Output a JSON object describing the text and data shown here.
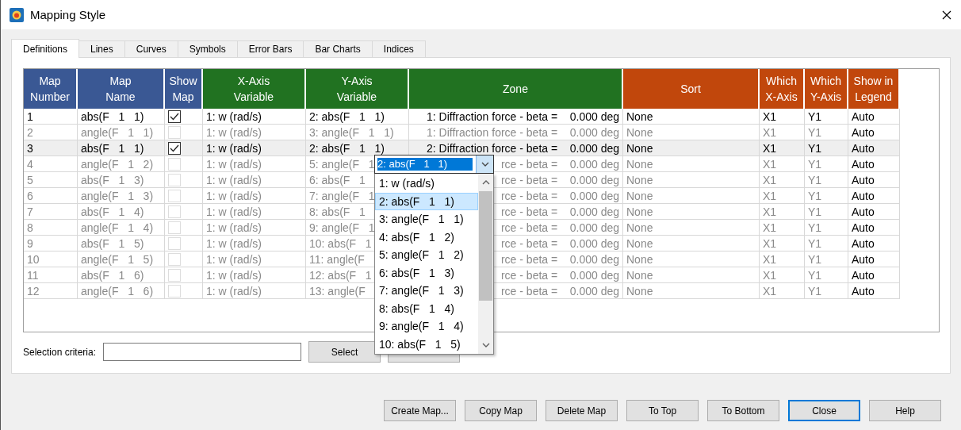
{
  "window": {
    "title": "Mapping Style"
  },
  "tabs": [
    {
      "label": "Definitions",
      "selected": true
    },
    {
      "label": "Lines",
      "selected": false
    },
    {
      "label": "Curves",
      "selected": false
    },
    {
      "label": "Symbols",
      "selected": false
    },
    {
      "label": "Error Bars",
      "selected": false
    },
    {
      "label": "Bar Charts",
      "selected": false
    },
    {
      "label": "Indices",
      "selected": false
    }
  ],
  "table": {
    "columns": [
      {
        "label": "Map Number",
        "color": "#3a5894"
      },
      {
        "label": "Map Name",
        "color": "#3a5894"
      },
      {
        "label": "Show Map",
        "color": "#3a5894"
      },
      {
        "label": "X-Axis Variable",
        "color": "#217221"
      },
      {
        "label": "Y-Axis Variable",
        "color": "#217221"
      },
      {
        "label": "Zone",
        "color": "#217221"
      },
      {
        "label": "Sort",
        "color": "#c1470c"
      },
      {
        "label": "Which X-Axis",
        "color": "#c1470c"
      },
      {
        "label": "Which Y-Axis",
        "color": "#c1470c"
      },
      {
        "label": "Show in Legend",
        "color": "#c1470c"
      }
    ],
    "rows": [
      {
        "number": "1",
        "name": "abs(F   1   1)",
        "show": true,
        "selected": false,
        "x": "1: w (rad/s)",
        "y": "2: abs(F   1   1)",
        "zone": "1: Diffraction force - beta =    0.000 deg",
        "sort": "None",
        "which_x": "X1",
        "which_y": "Y1",
        "legend": "Auto"
      },
      {
        "number": "2",
        "name": "angle(F   1   1)",
        "show": false,
        "selected": false,
        "x": "1: w (rad/s)",
        "y": "3: angle(F   1   1)",
        "zone": "1: Diffraction force - beta =    0.000 deg",
        "sort": "None",
        "which_x": "X1",
        "which_y": "Y1",
        "legend": "Auto"
      },
      {
        "number": "3",
        "name": "abs(F   1   1)",
        "show": true,
        "selected": true,
        "x": "1: w (rad/s)",
        "y": "2: abs(F   1   1)",
        "zone": "2: Diffraction force - beta =    0.000 deg",
        "sort": "None",
        "which_x": "X1",
        "which_y": "Y1",
        "legend": "Auto"
      },
      {
        "number": "4",
        "name": "angle(F   1   2)",
        "show": false,
        "selected": false,
        "x": "1: w (rad/s)",
        "y": "5: angle(F   1",
        "zone": "rce - beta =    0.000 deg",
        "sort": "None",
        "which_x": "X1",
        "which_y": "Y1",
        "legend": "Auto"
      },
      {
        "number": "5",
        "name": "abs(F   1   3)",
        "show": false,
        "selected": false,
        "x": "1: w (rad/s)",
        "y": "6: abs(F   1",
        "zone": "rce - beta =    0.000 deg",
        "sort": "None",
        "which_x": "X1",
        "which_y": "Y1",
        "legend": "Auto"
      },
      {
        "number": "6",
        "name": "angle(F   1   3)",
        "show": false,
        "selected": false,
        "x": "1: w (rad/s)",
        "y": "7: angle(F   1",
        "zone": "rce - beta =    0.000 deg",
        "sort": "None",
        "which_x": "X1",
        "which_y": "Y1",
        "legend": "Auto"
      },
      {
        "number": "7",
        "name": "abs(F   1   4)",
        "show": false,
        "selected": false,
        "x": "1: w (rad/s)",
        "y": "8: abs(F   1",
        "zone": "rce - beta =    0.000 deg",
        "sort": "None",
        "which_x": "X1",
        "which_y": "Y1",
        "legend": "Auto"
      },
      {
        "number": "8",
        "name": "angle(F   1   4)",
        "show": false,
        "selected": false,
        "x": "1: w (rad/s)",
        "y": "9: angle(F   1",
        "zone": "rce - beta =    0.000 deg",
        "sort": "None",
        "which_x": "X1",
        "which_y": "Y1",
        "legend": "Auto"
      },
      {
        "number": "9",
        "name": "abs(F   1   5)",
        "show": false,
        "selected": false,
        "x": "1: w (rad/s)",
        "y": "10: abs(F   1",
        "zone": "rce - beta =    0.000 deg",
        "sort": "None",
        "which_x": "X1",
        "which_y": "Y1",
        "legend": "Auto"
      },
      {
        "number": "10",
        "name": "angle(F   1   5)",
        "show": false,
        "selected": false,
        "x": "1: w (rad/s)",
        "y": "11: angle(F",
        "zone": "rce - beta =    0.000 deg",
        "sort": "None",
        "which_x": "X1",
        "which_y": "Y1",
        "legend": "Auto"
      },
      {
        "number": "11",
        "name": "abs(F   1   6)",
        "show": false,
        "selected": false,
        "x": "1: w (rad/s)",
        "y": "12: abs(F   1",
        "zone": "rce - beta =    0.000 deg",
        "sort": "None",
        "which_x": "X1",
        "which_y": "Y1",
        "legend": "Auto"
      },
      {
        "number": "12",
        "name": "angle(F   1   6)",
        "show": false,
        "selected": false,
        "x": "1: w (rad/s)",
        "y": "13: angle(F",
        "zone": "rce - beta =    0.000 deg",
        "sort": "None",
        "which_x": "X1",
        "which_y": "Y1",
        "legend": "Auto"
      }
    ]
  },
  "dropdown": {
    "value": "2: abs(F   1   1)",
    "options": [
      {
        "label": "1: w (rad/s)",
        "selected": false
      },
      {
        "label": "2: abs(F   1   1)",
        "selected": true
      },
      {
        "label": "3: angle(F   1   1)",
        "selected": false
      },
      {
        "label": "4: abs(F   1   2)",
        "selected": false
      },
      {
        "label": "5: angle(F   1   2)",
        "selected": false
      },
      {
        "label": "6: abs(F   1   3)",
        "selected": false
      },
      {
        "label": "7: angle(F   1   3)",
        "selected": false
      },
      {
        "label": "8: abs(F   1   4)",
        "selected": false
      },
      {
        "label": "9: angle(F   1   4)",
        "selected": false
      },
      {
        "label": "10: abs(F   1   5)",
        "selected": false
      }
    ]
  },
  "selection": {
    "label": "Selection criteria:",
    "button": "Select"
  },
  "buttons": [
    {
      "label": "Create Map...",
      "default": false
    },
    {
      "label": "Copy Map",
      "default": false
    },
    {
      "label": "Delete Map",
      "default": false
    },
    {
      "label": "To Top",
      "default": false
    },
    {
      "label": "To Bottom",
      "default": false
    },
    {
      "label": "Close",
      "default": true
    },
    {
      "label": "Help",
      "default": false
    }
  ]
}
